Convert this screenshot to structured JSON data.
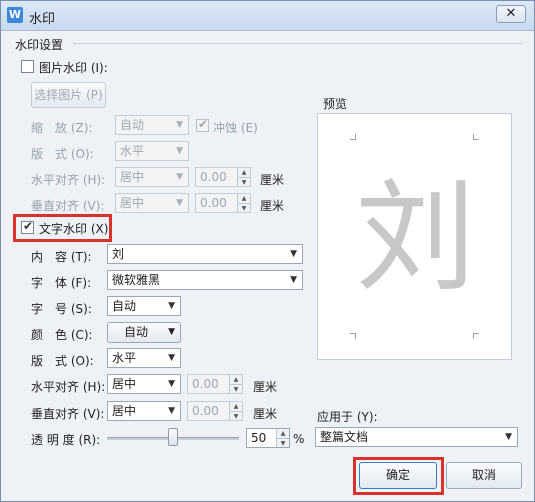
{
  "window": {
    "title": "水印",
    "close_glyph": "✕"
  },
  "group_title": "水印设置",
  "picture": {
    "checkbox_label": "图片水印 (I):",
    "select_button": "选择图片 (P)",
    "scale_label": "缩　放 (Z):",
    "scale_value": "自动",
    "washout_label": "冲蚀 (E)",
    "layout_label": "版　式 (O):",
    "layout_value": "水平",
    "halign_label": "水平对齐 (H):",
    "halign_value": "居中",
    "halign_offset": "0.00",
    "valign_label": "垂直对齐 (V):",
    "valign_value": "居中",
    "valign_offset": "0.00",
    "unit": "厘米"
  },
  "text": {
    "checkbox_label": "文字水印 (X)",
    "content_label": "内　容 (T):",
    "content_value": "刘",
    "font_label": "字　体 (F):",
    "font_value": "微软雅黑",
    "size_label": "字　号 (S):",
    "size_value": "自动",
    "color_label": "颜　色 (C):",
    "color_value": "自动",
    "layout_label": "版　式 (O):",
    "layout_value": "水平",
    "halign_label": "水平对齐 (H):",
    "halign_value": "居中",
    "halign_offset": "0.00",
    "valign_label": "垂直对齐 (V):",
    "valign_value": "居中",
    "valign_offset": "0.00",
    "unit": "厘米",
    "transparency_label": "透 明 度 (R):",
    "transparency_value": "50",
    "transparency_unit": "%"
  },
  "preview": {
    "label": "预览",
    "char": "刘"
  },
  "apply": {
    "label": "应用于 (Y):",
    "value": "整篇文档"
  },
  "buttons": {
    "ok": "确定",
    "cancel": "取消"
  },
  "colors": {
    "highlight": "#d9322b",
    "accent": "#3b87d8"
  }
}
